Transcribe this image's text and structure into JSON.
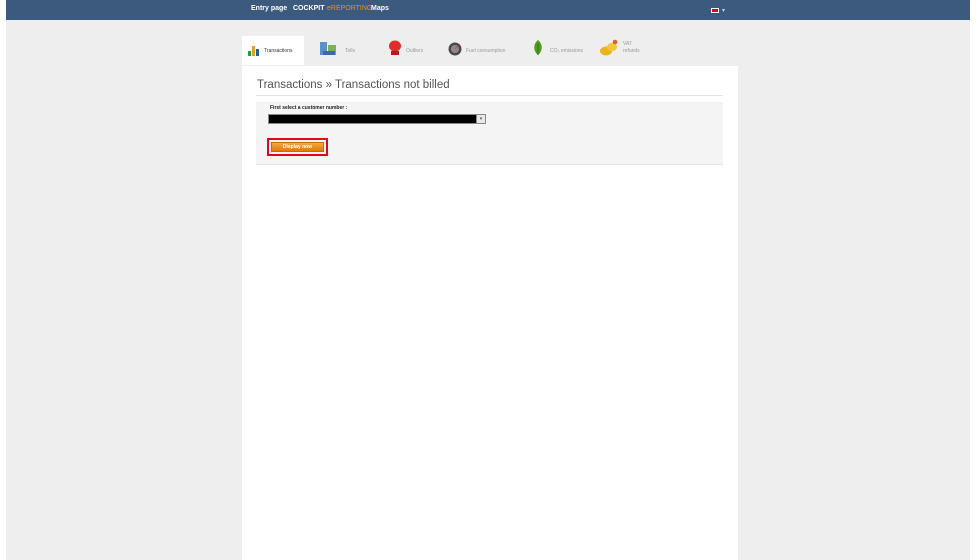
{
  "topnav": {
    "items": [
      {
        "label": "Entry page",
        "active": false
      },
      {
        "label": "COCKPIT",
        "active": false
      },
      {
        "label": "eREPORTING",
        "active": true
      },
      {
        "label": "Maps",
        "active": false
      }
    ]
  },
  "tabs": [
    {
      "label": "Transactions",
      "icon": "bar-chart-icon",
      "active": true
    },
    {
      "label": "Tolls",
      "icon": "toll-icon",
      "active": false
    },
    {
      "label": "Outliers",
      "icon": "boxing-glove-icon",
      "active": false
    },
    {
      "label": "Fuel consumption",
      "icon": "fuel-gauge-icon",
      "active": false
    },
    {
      "label": "CO₂ emissions",
      "icon": "leaf-icon",
      "active": false
    },
    {
      "label": "VAT",
      "label2": "refunds",
      "icon": "coins-icon",
      "active": false
    }
  ],
  "page": {
    "title": "Transactions » Transactions not billed"
  },
  "form": {
    "select_label": "First select a customer number :",
    "select_value": "",
    "button_label": "Display now"
  },
  "colors": {
    "topbar": "#3c5a7d",
    "active_nav": "#f08a24",
    "button": "#f0901e",
    "highlight": "#e3061a"
  }
}
